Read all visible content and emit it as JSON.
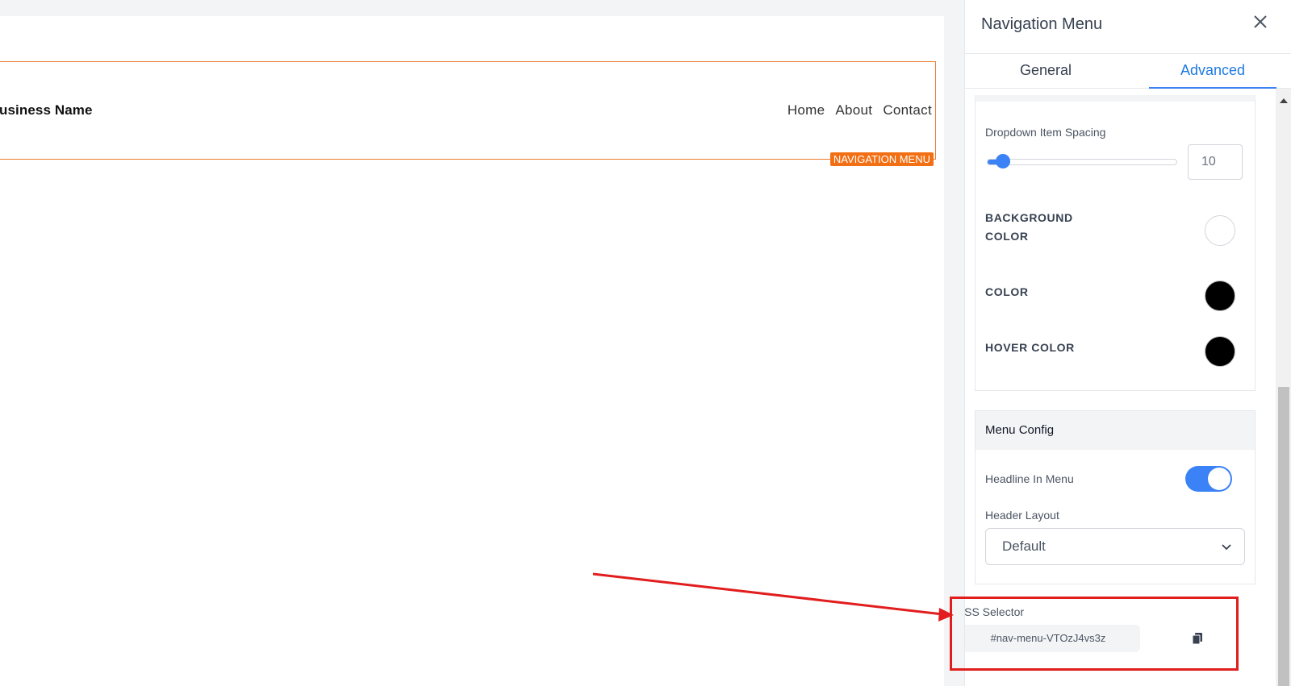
{
  "canvas": {
    "business_name": "usiness Name",
    "menu_items": [
      "Home",
      "About",
      "Contact"
    ],
    "badge": "NAVIGATION MENU"
  },
  "panel": {
    "title": "Navigation Menu",
    "tabs": {
      "general": "General",
      "advanced": "Advanced",
      "active": "Advanced"
    },
    "dropdown_item_spacing": {
      "label": "Dropdown Item Spacing",
      "value": "10",
      "slider_fraction": 0.12
    },
    "background_color": {
      "label": "BACKGROUND COLOR",
      "value": "#ffffff"
    },
    "color": {
      "label": "COLOR",
      "value": "#000000"
    },
    "hover_color": {
      "label": "HOVER COLOR",
      "value": "#000000"
    },
    "menu_config": {
      "heading": "Menu Config",
      "headline_in_menu": {
        "label": "Headline In Menu",
        "enabled": true
      },
      "header_layout": {
        "label": "Header Layout",
        "value": "Default"
      }
    },
    "css_selector": {
      "label": "CSS Selector",
      "value": "#nav-menu-VTOzJ4vs3z"
    }
  },
  "colors": {
    "accent": "#3b82f6",
    "badge": "#f26f14",
    "annotation": "#e11d1d"
  },
  "icons": [
    "close-icon",
    "chevron-down-icon",
    "copy-icon",
    "scroll-up-icon"
  ]
}
